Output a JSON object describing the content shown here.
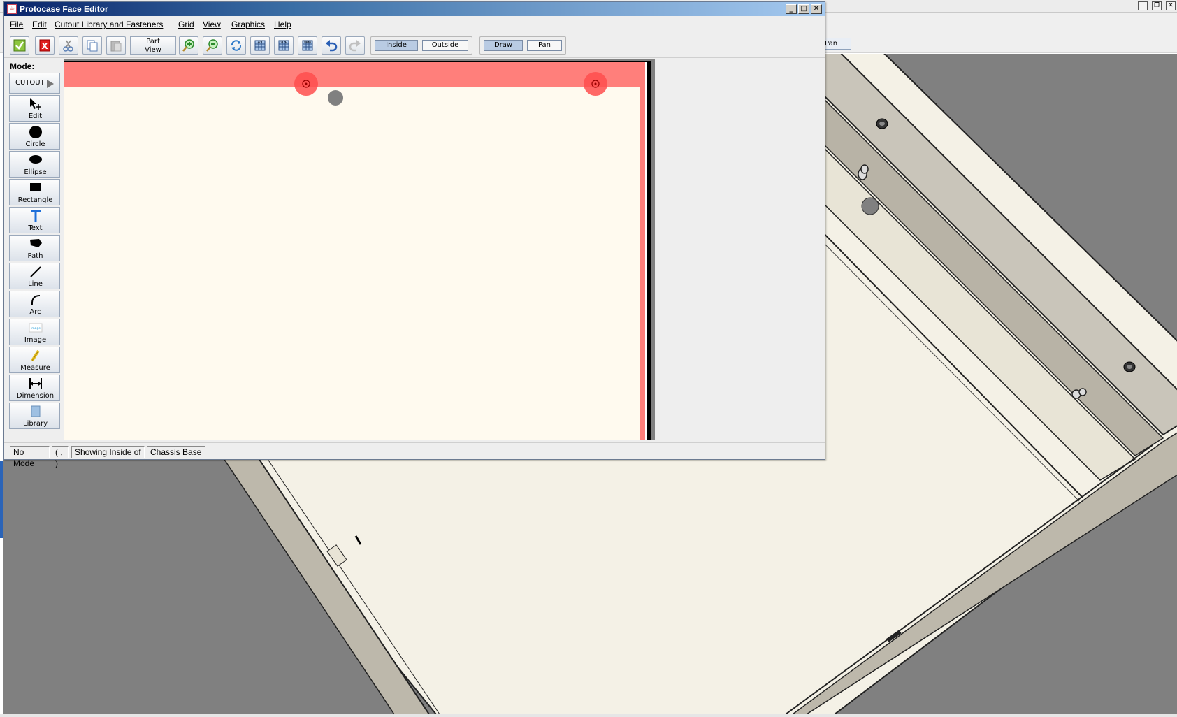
{
  "background_app": {
    "pan_label": "Pan",
    "window_controls": [
      "_",
      "❐",
      "✕"
    ]
  },
  "editor": {
    "title": "Protocase Face Editor",
    "app_icon": "java-icon",
    "window_controls": [
      "_",
      "□",
      "✕"
    ],
    "menus": [
      {
        "label": "File"
      },
      {
        "label": "Edit"
      },
      {
        "label": "Cutout Library and Fasteners"
      },
      {
        "label": "Grid"
      },
      {
        "label": "View"
      },
      {
        "label": "Graphics"
      },
      {
        "label": "Help"
      }
    ],
    "toolbar": {
      "icons": [
        "ok-check-icon",
        "cancel-x-icon",
        "cut-scissors-icon",
        "copy-icon",
        "paste-icon",
        "zoom-in-icon",
        "zoom-out-icon",
        "refresh-view-icon",
        "grid-icon",
        "size-grid-icon",
        "snap-grid-icon",
        "undo-icon",
        "redo-icon"
      ],
      "part_view_line1": "Part",
      "part_view_line2": "View",
      "grid_label": "GRID",
      "size_label": "SIZE",
      "snap_label": "SNAP",
      "inside_label": "Inside",
      "outside_label": "Outside",
      "draw_label": "Draw",
      "pan_label": "Pan",
      "inside_active": true,
      "draw_active": true
    },
    "mode": {
      "label": "Mode:",
      "cutout_label": "CUTOUT",
      "tools": [
        {
          "label": "Edit",
          "icon": "edit-pointer-icon"
        },
        {
          "label": "Circle",
          "icon": "circle-icon"
        },
        {
          "label": "Ellipse",
          "icon": "ellipse-icon"
        },
        {
          "label": "Rectangle",
          "icon": "rectangle-icon"
        },
        {
          "label": "Text",
          "icon": "text-icon"
        },
        {
          "label": "Path",
          "icon": "path-icon"
        },
        {
          "label": "Line",
          "icon": "line-icon"
        },
        {
          "label": "Arc",
          "icon": "arc-icon"
        },
        {
          "label": "Image",
          "icon": "image-icon"
        },
        {
          "label": "Measure",
          "icon": "measure-icon"
        },
        {
          "label": "Dimension",
          "icon": "dimension-icon"
        },
        {
          "label": "Library",
          "icon": "library-icon"
        }
      ],
      "image_tool_glyph": "Image"
    },
    "status": {
      "mode": "No Mode",
      "coords": "( , )",
      "showing": "Showing Inside of",
      "part": "Chassis Base"
    },
    "colors": {
      "face_fill": "#fffaef",
      "flange_band": "#ff7f7b",
      "fastener_highlight": "#ff4d4d",
      "grey_hole": "#808080",
      "canvas_background": "#808080"
    }
  }
}
